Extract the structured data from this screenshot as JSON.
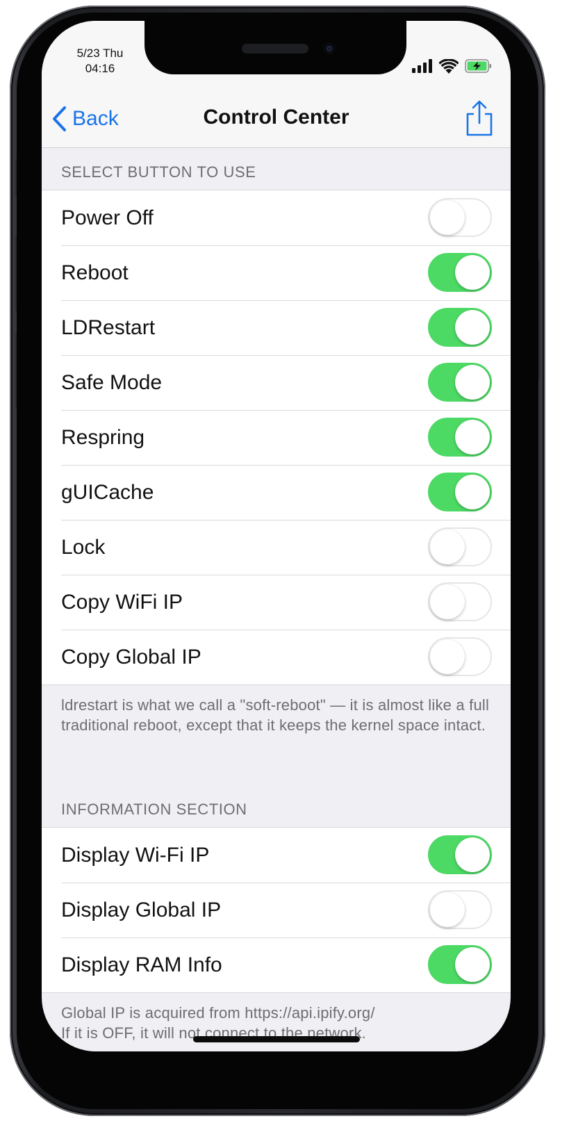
{
  "status_bar": {
    "date": "5/23 Thu",
    "time": "04:16"
  },
  "nav": {
    "back_label": "Back",
    "title": "Control Center",
    "share_icon": "share-icon"
  },
  "sections": {
    "buttons": {
      "header": "SELECT BUTTON TO USE",
      "items": [
        {
          "label": "Power Off",
          "on": false
        },
        {
          "label": "Reboot",
          "on": true
        },
        {
          "label": "LDRestart",
          "on": true
        },
        {
          "label": "Safe Mode",
          "on": true
        },
        {
          "label": "Respring",
          "on": true
        },
        {
          "label": "gUICache",
          "on": true
        },
        {
          "label": "Lock",
          "on": false
        },
        {
          "label": "Copy WiFi IP",
          "on": false
        },
        {
          "label": "Copy Global IP",
          "on": false
        }
      ],
      "footer": "ldrestart is what we call a \"soft-reboot\" — it is almost like a full traditional reboot, except that it keeps the kernel space intact."
    },
    "info": {
      "header": "INFORMATION SECTION",
      "items": [
        {
          "label": "Display Wi-Fi IP",
          "on": true
        },
        {
          "label": "Display Global IP",
          "on": false
        },
        {
          "label": "Display RAM Info",
          "on": true
        }
      ],
      "footer_line1": "Global IP is acquired from https://api.ipify.org/",
      "footer_line2": "If it is OFF, it will not connect to the network."
    }
  },
  "colors": {
    "accent": "#1a73e8",
    "switch_on": "#4cd964",
    "battery": "#4cd964"
  }
}
